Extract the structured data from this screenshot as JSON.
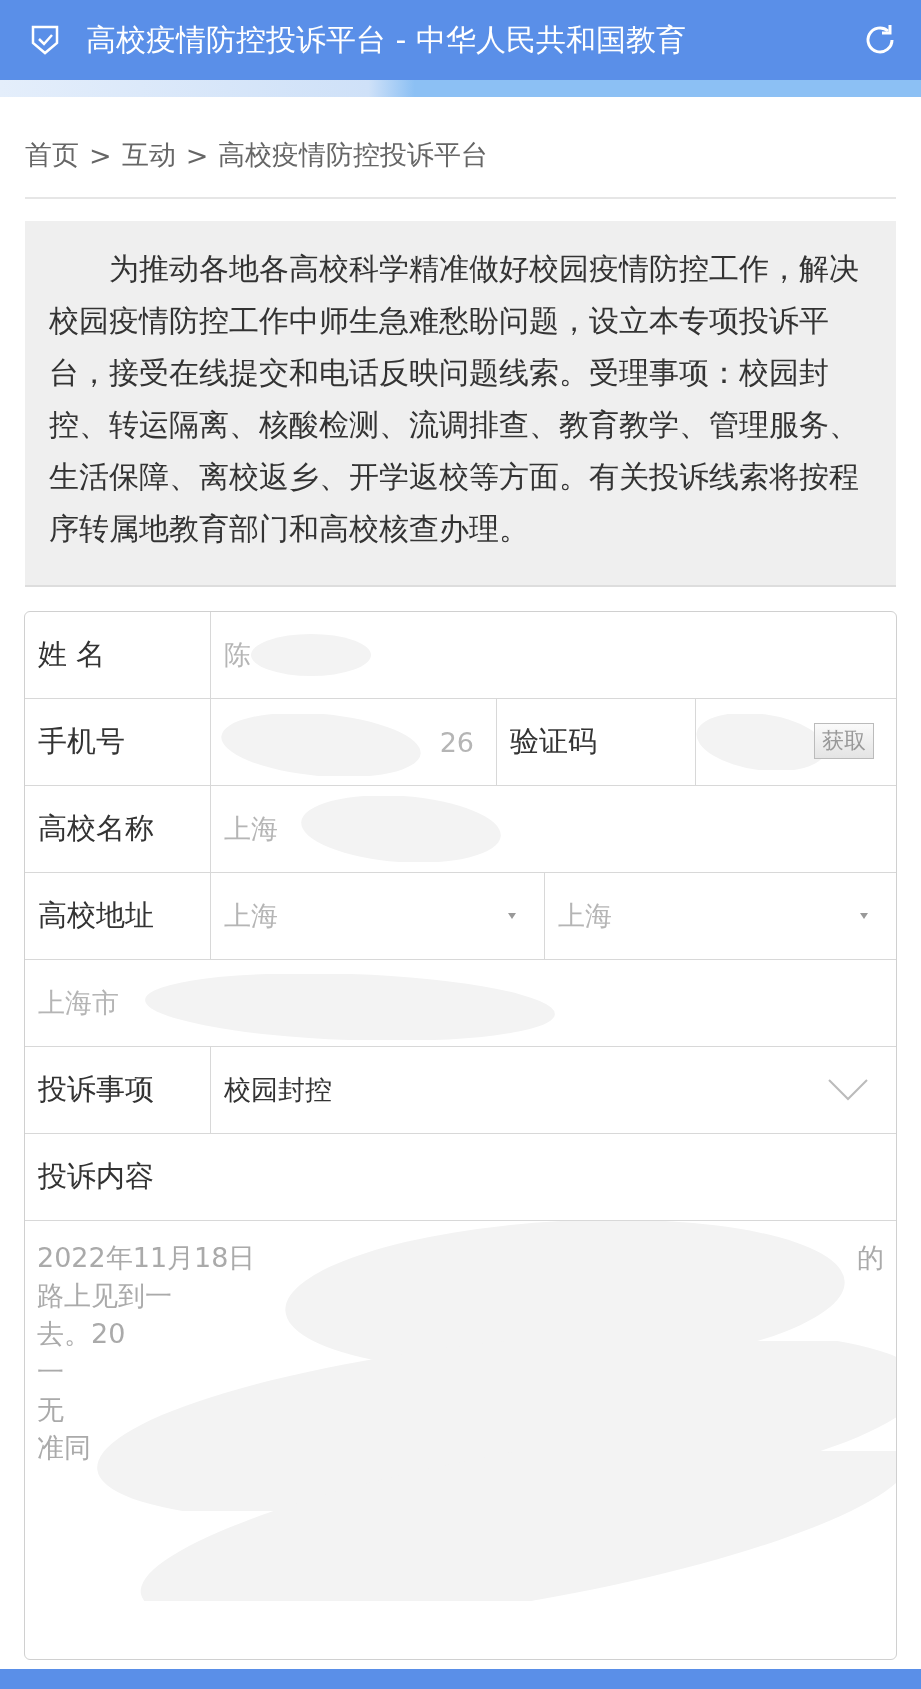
{
  "header": {
    "title": "高校疫情防控投诉平台 - 中华人民共和国教育"
  },
  "breadcrumb": [
    "首页",
    "互动",
    "高校疫情防控投诉平台"
  ],
  "breadcrumb_separator": ">",
  "notice": "为推动各地各高校科学精准做好校园疫情防控工作，解决校园疫情防控工作中师生急难愁盼问题，设立本专项投诉平台，接受在线提交和电话反映问题线索。受理事项：校园封控、转运隔离、核酸检测、流调排查、教育教学、管理服务、生活保障、离校返乡、开学返校等方面。有关投诉线索将按程序转属地教育部门和高校核查办理。",
  "form": {
    "name": {
      "label": "姓 名",
      "value": "陈"
    },
    "phone": {
      "label": "手机号",
      "value": "26",
      "code_label": "验证码",
      "code_button": "获取"
    },
    "school": {
      "label": "高校名称",
      "value": "上海"
    },
    "address": {
      "label": "高校地址",
      "province": "上海",
      "city": "上海",
      "detail": "上海市"
    },
    "category": {
      "label": "投诉事项",
      "value": "校园封控"
    },
    "content": {
      "label": "投诉内容",
      "lines": [
        {
          "left": "2022年11月18日",
          "right": "的"
        },
        {
          "left": "路上见到一"
        },
        {
          "left": "去。20"
        },
        {
          "left": "一"
        },
        {
          "left": "无"
        },
        {
          "left": "准同"
        }
      ]
    }
  }
}
